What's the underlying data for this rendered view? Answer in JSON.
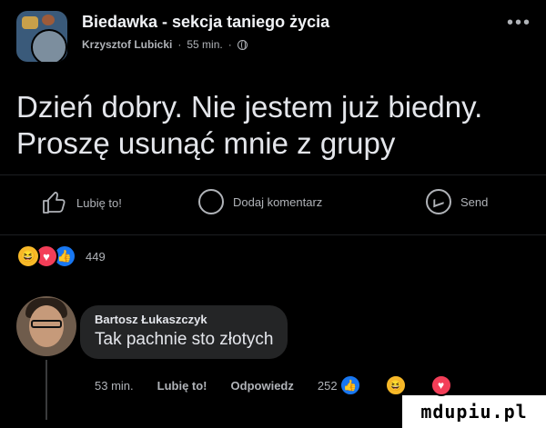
{
  "post": {
    "group_name": "Biedawka - sekcja taniego życia",
    "author": "Krzysztof Lubicki",
    "time": "55 min.",
    "separator": "·",
    "text_line1": "Dzień dobry. Nie jestem już biedny.",
    "text_line2": "Proszę usunąć mnie z grupy",
    "more_icon": "more-dots-icon"
  },
  "actions": {
    "like_label": "Lubię to!",
    "comment_label": "Dodaj komentarz",
    "send_label": "Send"
  },
  "reactions": {
    "count": "449",
    "types": [
      "haha",
      "love",
      "like"
    ]
  },
  "comment": {
    "author": "Bartosz Łukaszczyk",
    "text": "Tak pachnie sto złotych",
    "time": "53 min.",
    "like_label": "Lubię to!",
    "reply_label": "Odpowiedz",
    "reaction_count": "252",
    "reaction_types": [
      "like",
      "haha",
      "love"
    ]
  },
  "watermark": "mdupiu.pl",
  "colors": {
    "background": "#000000",
    "text": "#e4e6eb",
    "secondary_text": "#b0b3b8",
    "bubble": "#242526",
    "like_blue": "#1877f2",
    "love_red": "#f33e58",
    "haha_yellow": "#f7b928"
  }
}
